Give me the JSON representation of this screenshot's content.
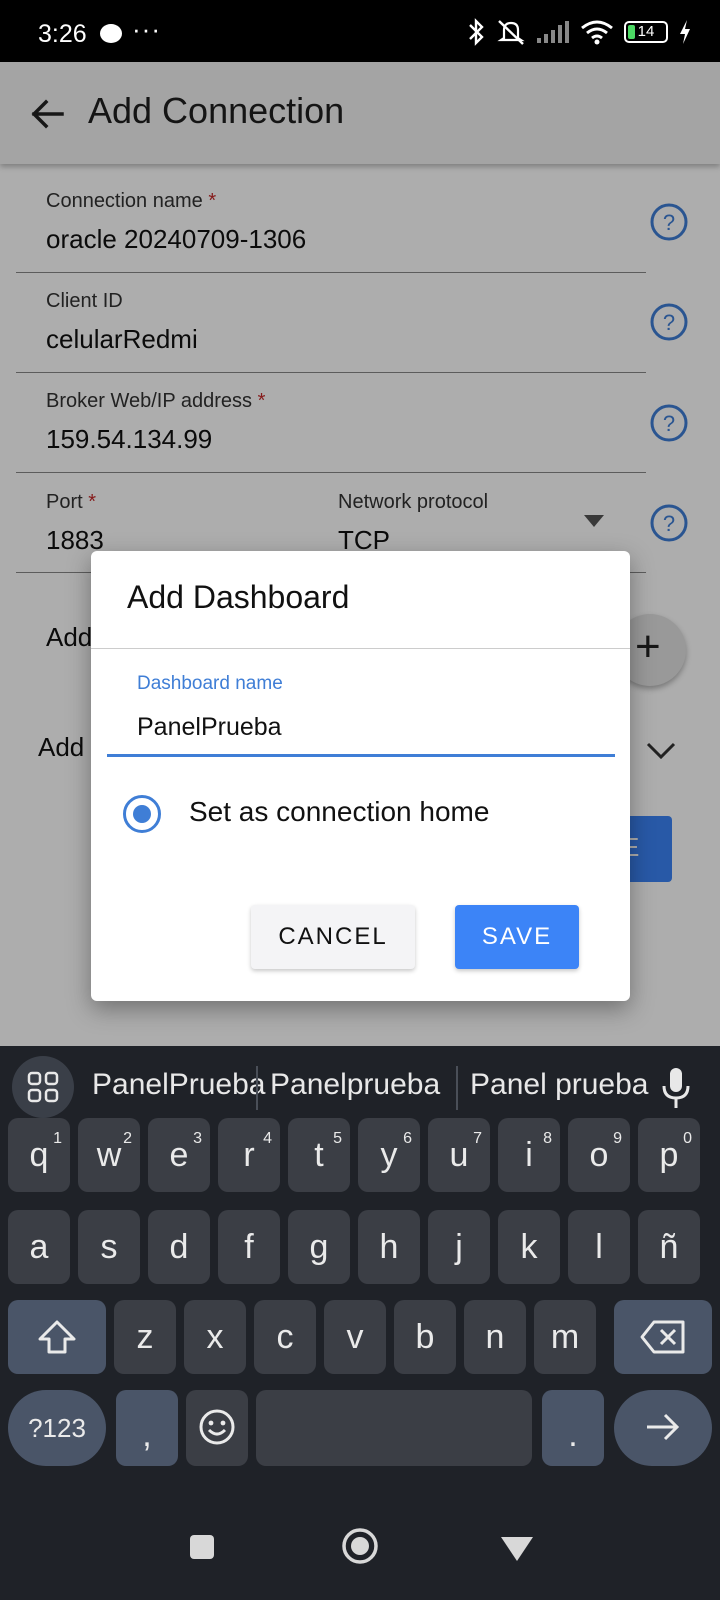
{
  "status_bar": {
    "time": "3:26",
    "more": "···",
    "battery": "14"
  },
  "app_bar": {
    "title": "Add Connection"
  },
  "form": {
    "connection_name_label": "Connection name",
    "connection_name_value": "oracle 20240709-1306",
    "client_id_label": "Client ID",
    "client_id_value": "celularRedmi",
    "broker_label": "Broker Web/IP address",
    "broker_value": "159.54.134.99",
    "port_label": "Port",
    "port_value": "1883",
    "protocol_label": "Network protocol",
    "protocol_value": "TCP",
    "required_mark": "*",
    "hidden_row1_text": "Add",
    "hidden_row2_text": "Add",
    "fab_label": "+",
    "hidden_button_text": "E"
  },
  "dialog": {
    "title": "Add Dashboard",
    "input_label": "Dashboard name",
    "input_value": "PanelPrueba",
    "radio_label": "Set as connection home",
    "radio_checked": true,
    "cancel_label": "CANCEL",
    "save_label": "SAVE"
  },
  "keyboard": {
    "suggestions": [
      "PanelPrueba",
      "Panelprueba",
      "Panel prueba"
    ],
    "row1": [
      {
        "k": "q",
        "n": "1"
      },
      {
        "k": "w",
        "n": "2"
      },
      {
        "k": "e",
        "n": "3"
      },
      {
        "k": "r",
        "n": "4"
      },
      {
        "k": "t",
        "n": "5"
      },
      {
        "k": "y",
        "n": "6"
      },
      {
        "k": "u",
        "n": "7"
      },
      {
        "k": "i",
        "n": "8"
      },
      {
        "k": "o",
        "n": "9"
      },
      {
        "k": "p",
        "n": "0"
      }
    ],
    "row2": [
      "a",
      "s",
      "d",
      "f",
      "g",
      "h",
      "j",
      "k",
      "l",
      "ñ"
    ],
    "row3": [
      "z",
      "x",
      "c",
      "v",
      "b",
      "n",
      "m"
    ],
    "symbols_label": "?123",
    "comma_label": ",",
    "period_label": "."
  },
  "colors": {
    "accent": "#3f7ed6",
    "button_blue": "#3c84f7",
    "required": "#c62828",
    "keyboard_bg": "#1f2228"
  }
}
